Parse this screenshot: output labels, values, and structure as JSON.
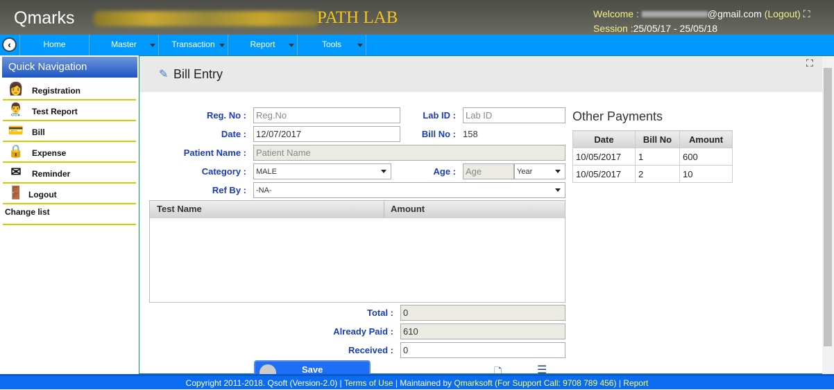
{
  "header": {
    "app_name": "Qmarks",
    "lab_name": "PATH LAB",
    "welcome_label": "Welcome :",
    "email_suffix": "@gmail.com",
    "logout": "(Logout)",
    "session_label": "Session :",
    "session_value": "25/05/17 - 25/05/18"
  },
  "nav": {
    "items": [
      {
        "label": "Home"
      },
      {
        "label": "Master"
      },
      {
        "label": "Transaction"
      },
      {
        "label": "Report"
      },
      {
        "label": "Tools"
      }
    ]
  },
  "sidebar": {
    "title": "Quick Navigation",
    "items": [
      {
        "label": "Registration",
        "icon": "user-icon"
      },
      {
        "label": "Test Report",
        "icon": "doctor-icon"
      },
      {
        "label": "Bill",
        "icon": "card-payment-icon"
      },
      {
        "label": "Expense",
        "icon": "lock-card-icon"
      },
      {
        "label": "Reminder",
        "icon": "mail-icon"
      },
      {
        "label": "Logout",
        "icon": "door-icon"
      }
    ],
    "change_list": "Change list"
  },
  "page": {
    "title": "Bill Entry"
  },
  "form": {
    "reg_no": {
      "label": "Reg. No :",
      "placeholder": "Reg.No",
      "value": ""
    },
    "lab_id": {
      "label": "Lab ID :",
      "placeholder": "Lab ID",
      "value": ""
    },
    "date": {
      "label": "Date :",
      "value": "12/07/2017"
    },
    "bill_no": {
      "label": "Bill No :",
      "value": "158"
    },
    "patient_name": {
      "label": "Patient Name :",
      "placeholder": "Patient Name"
    },
    "category": {
      "label": "Category :",
      "value": "MALE"
    },
    "age": {
      "label": "Age :",
      "placeholder": "Age",
      "unit": "Year"
    },
    "ref_by": {
      "label": "Ref By :",
      "value": "-NA-"
    },
    "tests_table": {
      "columns": [
        "Test Name",
        "Amount"
      ],
      "rows": []
    },
    "total": {
      "label": "Total :",
      "value": "0"
    },
    "already_paid": {
      "label": "Already Paid :",
      "value": "610"
    },
    "received": {
      "label": "Received :",
      "value": "0"
    },
    "save": "Save"
  },
  "other_payments": {
    "title": "Other Payments",
    "columns": [
      "Date",
      "Bill No",
      "Amount"
    ],
    "rows": [
      [
        "10/05/2017",
        "1",
        "600"
      ],
      [
        "10/05/2017",
        "2",
        "10"
      ]
    ]
  },
  "footer": {
    "copyright": "Copyright 2011-2018. Qsoft (Version-2.0) |",
    "terms": "Terms of Use",
    "maintained": "| Maintained by",
    "company": "Qmarksoft (For Support Call: 9708 789 456)",
    "sep": "|",
    "report": "Report"
  }
}
